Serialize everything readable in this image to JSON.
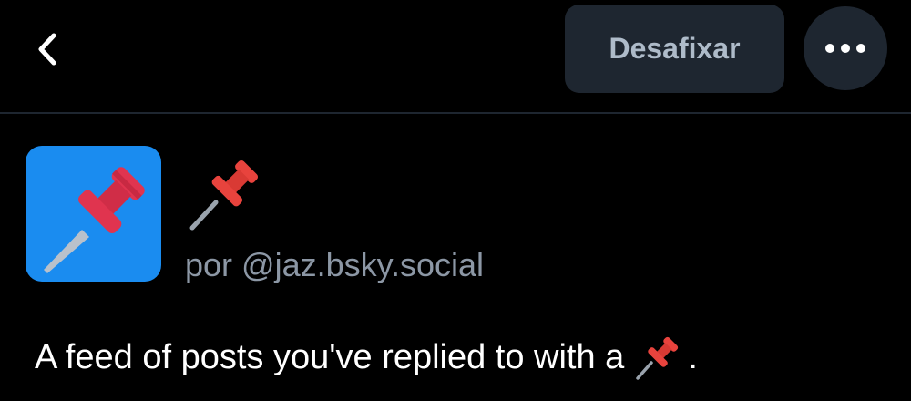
{
  "header": {
    "back_icon": "chevron-left-icon",
    "unpin_label": "Desafixar",
    "more_icon": "ellipsis-icon"
  },
  "feed": {
    "avatar_icon": "pushpin-icon",
    "title_icon": "pushpin-emoji",
    "author": "por @jaz.bsky.social",
    "description_before": "A feed of posts you've replied to with a",
    "description_icon": "pushpin-emoji",
    "description_after": "."
  },
  "colors": {
    "background": "#000000",
    "button_bg": "#1e2630",
    "button_text": "#aebbc9",
    "muted_text": "#8c97a5",
    "avatar_bg": "#1a8cf0",
    "pin_red": "#d8334a",
    "divider": "#1e2630"
  }
}
